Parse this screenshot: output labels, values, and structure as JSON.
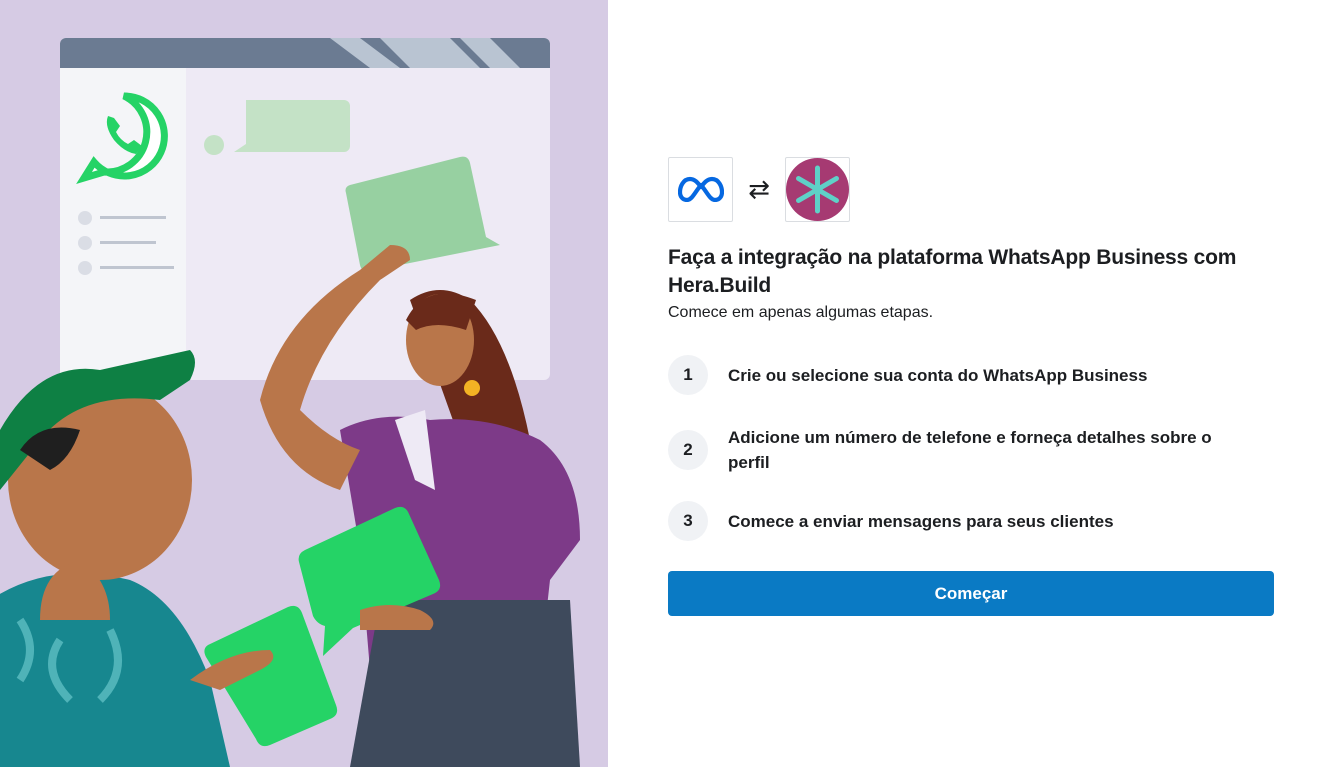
{
  "header": {
    "title": "Faça a integração na plataforma WhatsApp Business com Hera.Build",
    "subtitle": "Comece em apenas algumas etapas."
  },
  "logos": {
    "left": "meta-logo-icon",
    "swap": "⇄",
    "right": "hera-build-logo-icon",
    "meta_color": "#0668e1",
    "hera_color": "#a63a72"
  },
  "steps": [
    {
      "number": "1",
      "text": "Crie ou selecione sua conta do WhatsApp Business"
    },
    {
      "number": "2",
      "text": "Adicione um número de telefone e forneça detalhes sobre o perfil"
    },
    {
      "number": "3",
      "text": "Comece a enviar mensagens para seus clientes"
    }
  ],
  "cta": {
    "label": "Começar",
    "color": "#0a7ac4"
  },
  "illustration": {
    "icon": "whatsapp-icon",
    "background": "#d6cbe4"
  }
}
